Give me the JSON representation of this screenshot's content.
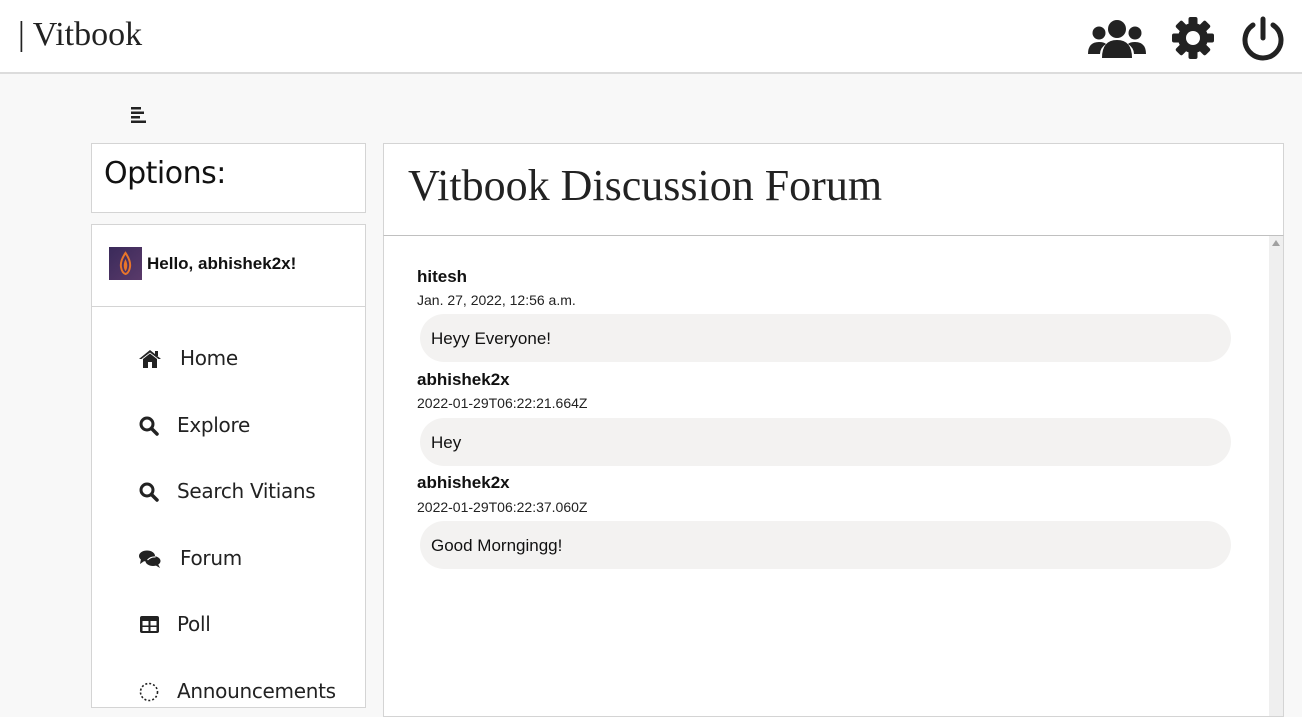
{
  "navbar": {
    "brand": "| Vitbook",
    "icons": [
      "users-icon",
      "gear-icon",
      "power-icon"
    ]
  },
  "sidebar": {
    "options_title": "Options:",
    "greeting": "Hello, abhishek2x!",
    "items": [
      {
        "label": "Home",
        "icon": "home-icon"
      },
      {
        "label": "Explore",
        "icon": "search-icon"
      },
      {
        "label": "Search Vitians",
        "icon": "search-icon"
      },
      {
        "label": "Forum",
        "icon": "comments-icon"
      },
      {
        "label": "Poll",
        "icon": "table-icon"
      },
      {
        "label": "Announcements",
        "icon": "circle-notch-icon"
      }
    ]
  },
  "forum": {
    "title": "Vitbook Discussion Forum",
    "messages": [
      {
        "author": "hitesh",
        "time": "Jan. 27, 2022, 12:56 a.m.",
        "text": "Heyy Everyone!"
      },
      {
        "author": "abhishek2x",
        "time": "2022-01-29T06:22:21.664Z",
        "text": "Hey"
      },
      {
        "author": "abhishek2x",
        "time": "2022-01-29T06:22:37.060Z",
        "text": "Good Morngingg!"
      }
    ]
  },
  "colors": {
    "background": "#f8f8f8",
    "panel": "#ffffff",
    "bubble": "#f3f2f1",
    "icon": "#222222"
  }
}
